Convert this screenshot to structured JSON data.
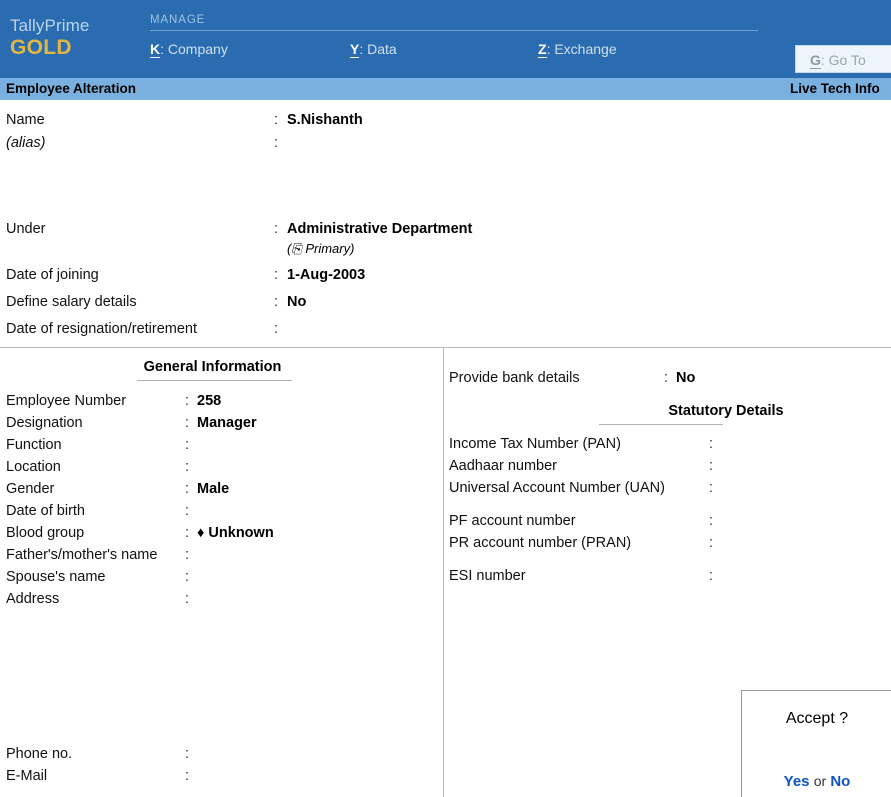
{
  "colors": {
    "header_blue": "#2b6cb0",
    "title_strip_blue": "#79b0e0",
    "brand_gold": "#e2b645",
    "link_blue": "#0d52c7",
    "rule_gray": "#b9b9b9"
  },
  "header": {
    "brand_name": "TallyPrime",
    "brand_edition": "GOLD",
    "menu_title": "MANAGE",
    "menu_items": [
      {
        "key": "K",
        "sep": ":",
        "label": "Company"
      },
      {
        "key": "Y",
        "sep": ":",
        "label": "Data"
      },
      {
        "key": "Z",
        "sep": ":",
        "label": "Exchange"
      }
    ],
    "goto": {
      "key": "G",
      "sep": ":",
      "label": "Go To"
    }
  },
  "title_strip": {
    "screen_title": "Employee  Alteration",
    "right_label": "Live Tech Info"
  },
  "upper_form": {
    "rows": [
      {
        "label": "Name",
        "colon": ":",
        "value": "S.Nishanth",
        "sub": ""
      },
      {
        "label": "(alias)",
        "colon": ":",
        "value": "",
        "sub": ""
      },
      {
        "label": "Under",
        "colon": ":",
        "value": "Administrative Department",
        "sub": "(⎘  Primary)"
      },
      {
        "label": "Date of joining",
        "colon": ":",
        "value": "1-Aug-2003",
        "sub": ""
      },
      {
        "label": "Define salary details",
        "colon": ":",
        "value": "No",
        "sub": ""
      },
      {
        "label": "Date of resignation/retirement",
        "colon": ":",
        "value": "",
        "sub": ""
      }
    ]
  },
  "general_information": {
    "section_title": "General Information",
    "rows": [
      {
        "label": "Employee Number",
        "colon": ":",
        "value": "258"
      },
      {
        "label": "Designation",
        "colon": ":",
        "value": "Manager"
      },
      {
        "label": "Function",
        "colon": ":",
        "value": ""
      },
      {
        "label": "Location",
        "colon": ":",
        "value": ""
      },
      {
        "label": "Gender",
        "colon": ":",
        "value": "Male"
      },
      {
        "label": "Date of birth",
        "colon": ":",
        "value": ""
      },
      {
        "label": "Blood group",
        "colon": ":",
        "value": "♦ Unknown"
      },
      {
        "label": "Father's/mother's name",
        "colon": ":",
        "value": ""
      },
      {
        "label": "Spouse's name",
        "colon": ":",
        "value": ""
      },
      {
        "label": "Address",
        "colon": ":",
        "value": ""
      }
    ],
    "contact_rows": [
      {
        "label": "Phone no.",
        "colon": ":",
        "value": ""
      },
      {
        "label": "E-Mail",
        "colon": ":",
        "value": ""
      }
    ]
  },
  "bank_details": {
    "label": "Provide bank details",
    "colon": ":",
    "value": "No"
  },
  "statutory_details": {
    "section_title": "Statutory Details",
    "rows": [
      {
        "label": "Income Tax Number (PAN)",
        "colon": ":",
        "value": ""
      },
      {
        "label": "Aadhaar number",
        "colon": ":",
        "value": ""
      },
      {
        "label": "Universal Account Number (UAN)",
        "colon": ":",
        "value": ""
      },
      {
        "label": "PF account number",
        "colon": ":",
        "value": ""
      },
      {
        "label": "PR account number (PRAN)",
        "colon": ":",
        "value": ""
      },
      {
        "label": "ESI number",
        "colon": ":",
        "value": ""
      }
    ]
  },
  "accept_dialog": {
    "title": "Accept ?",
    "yes_label": "Yes",
    "or_label": "or",
    "no_label": "No"
  }
}
